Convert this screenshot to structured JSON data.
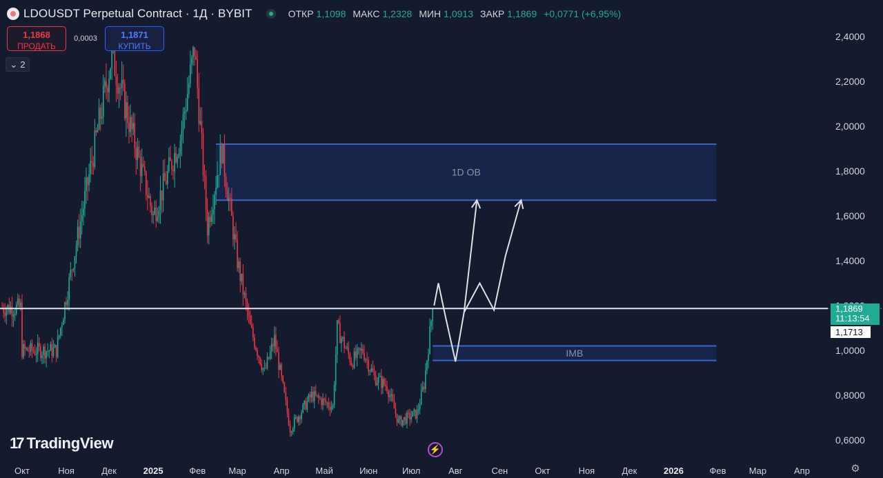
{
  "header": {
    "symbol_title": "LDOUSDT Perpetual Contract · 1Д · BYBIT",
    "ohlc": {
      "open_label": "ОТКР",
      "open_value": "1,1098",
      "high_label": "МАКС",
      "high_value": "1,2328",
      "low_label": "МИН",
      "low_value": "1,0913",
      "close_label": "ЗАКР",
      "close_value": "1,1869",
      "change": "+0,0771 (+6,95%)"
    },
    "value_color": "#22ab94"
  },
  "trade": {
    "sell_price": "1,1868",
    "sell_label": "ПРОДАТЬ",
    "spread": "0,0003",
    "buy_price": "1,1871",
    "buy_label": "КУПИТЬ"
  },
  "indicators_toggle": "2",
  "logo_text": "TradingView",
  "price_scale": {
    "current_price": "1,1869",
    "countdown": "11:13:54",
    "crosshair_price": "1,1713"
  },
  "colors": {
    "up": "#22ab94",
    "down": "#f23645",
    "zone": "#2962ff",
    "background": "#141b2e"
  },
  "icons": {
    "settings": "gear-icon",
    "flash": "lightning-icon",
    "toggle": "chevron-down-icon"
  },
  "chart_data": {
    "type": "candlestick",
    "y_axis": {
      "min": 0.55,
      "max": 2.45,
      "ticks": [
        "0,6000",
        "0,8000",
        "1,0000",
        "1,2000",
        "1,4000",
        "1,6000",
        "1,8000",
        "2,0000",
        "2,2000",
        "2,4000"
      ],
      "tick_values": [
        0.6,
        0.8,
        1.0,
        1.2,
        1.4,
        1.6,
        1.8,
        2.0,
        2.2,
        2.4
      ]
    },
    "x_axis": {
      "labels": [
        "Окт",
        "Ноя",
        "Дек",
        "2025",
        "Фев",
        "Мар",
        "Апр",
        "Май",
        "Июн",
        "Июл",
        "Авг",
        "Сен",
        "Окт",
        "Ноя",
        "Дек",
        "2026",
        "Фев",
        "Мар",
        "Апр"
      ],
      "bold_labels": [
        "2025",
        "2026"
      ]
    },
    "grid": false,
    "current_price_line": 1.1869,
    "zones": [
      {
        "label": "1D OB",
        "from_date": "2025-02-14",
        "to_date": "2026-01-31",
        "low": 1.67,
        "high": 1.92
      },
      {
        "label": "IMB",
        "from_date": "2025-07-16",
        "to_date": "2026-01-31",
        "low": 0.955,
        "high": 1.02
      }
    ],
    "projection_paths": [
      {
        "points": [
          [
            "2025-07-17",
            1.2
          ],
          [
            "2025-07-20",
            1.3
          ],
          [
            "2025-07-25",
            1.15
          ],
          [
            "2025-08-01",
            0.95
          ],
          [
            "2025-08-07",
            1.17
          ],
          [
            "2025-08-16",
            1.67
          ]
        ]
      },
      {
        "points": [
          [
            "2025-08-07",
            1.17
          ],
          [
            "2025-08-18",
            1.3
          ],
          [
            "2025-08-28",
            1.18
          ],
          [
            "2025-09-05",
            1.42
          ],
          [
            "2025-09-16",
            1.67
          ]
        ]
      }
    ],
    "path_color": "#dfe1e6",
    "key_points": [
      {
        "date": "2024-10-01",
        "price": 1.0
      },
      {
        "date": "2024-10-25",
        "price": 1.0
      },
      {
        "date": "2024-12-03",
        "price": 2.32
      },
      {
        "date": "2024-12-20",
        "price": 1.9
      },
      {
        "date": "2025-01-01",
        "price": 1.6
      },
      {
        "date": "2025-01-20",
        "price": 1.95
      },
      {
        "date": "2025-01-30",
        "price": 2.35
      },
      {
        "date": "2025-02-08",
        "price": 1.55
      },
      {
        "date": "2025-02-18",
        "price": 1.9
      },
      {
        "date": "2025-03-01",
        "price": 1.4
      },
      {
        "date": "2025-03-10",
        "price": 1.1
      },
      {
        "date": "2025-03-20",
        "price": 0.9
      },
      {
        "date": "2025-03-27",
        "price": 1.05
      },
      {
        "date": "2025-04-07",
        "price": 0.65
      },
      {
        "date": "2025-04-22",
        "price": 0.8
      },
      {
        "date": "2025-05-07",
        "price": 0.75
      },
      {
        "date": "2025-05-10",
        "price": 1.1
      },
      {
        "date": "2025-05-20",
        "price": 0.95
      },
      {
        "date": "2025-05-28",
        "price": 1.0
      },
      {
        "date": "2025-06-05",
        "price": 0.88
      },
      {
        "date": "2025-06-14",
        "price": 0.84
      },
      {
        "date": "2025-06-22",
        "price": 0.68
      },
      {
        "date": "2025-07-05",
        "price": 0.72
      },
      {
        "date": "2025-07-10",
        "price": 0.85
      },
      {
        "date": "2025-07-16",
        "price": 1.19
      }
    ]
  }
}
